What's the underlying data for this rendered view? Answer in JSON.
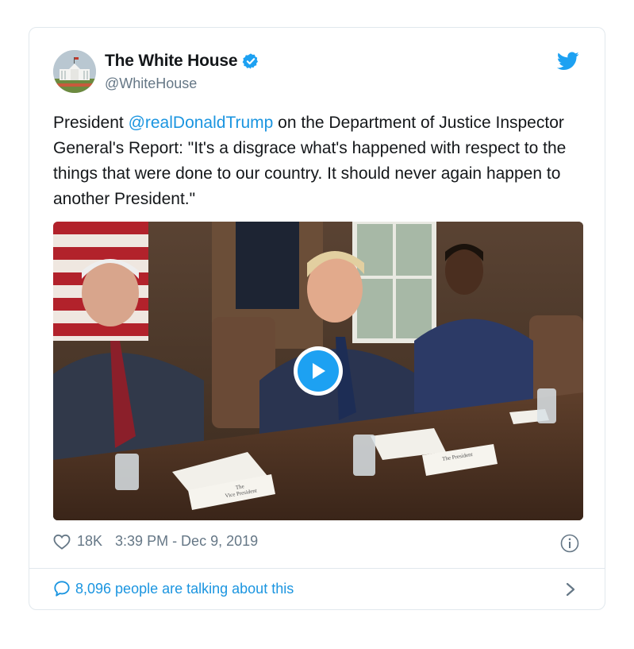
{
  "tweet": {
    "display_name": "The White House",
    "handle": "@WhiteHouse",
    "text_before": "President ",
    "mention": "@realDonaldTrump",
    "text_after": " on the Department of Justice Inspector General's Report: \"It's a disgrace what's happened with respect to the things that were done to our country. It should never again happen to another President.\"",
    "likes": "18K",
    "timestamp": "3:39 PM - Dec 9, 2019",
    "talking": "8,096 people are talking about this",
    "placards": {
      "left_line1": "The",
      "left_line2": "Vice President",
      "right": "The President"
    }
  },
  "icons": {
    "avatar": "white-house-avatar",
    "verified": "verified-badge-icon",
    "brand": "twitter-bird-icon",
    "play": "play-icon",
    "like": "heart-icon",
    "info": "info-icon",
    "reply": "speech-bubble-icon",
    "chevron": "chevron-right-icon"
  },
  "colors": {
    "accent": "#1da1f2",
    "link": "#1b95e0",
    "muted": "#657786",
    "border": "#e1e8ed"
  }
}
